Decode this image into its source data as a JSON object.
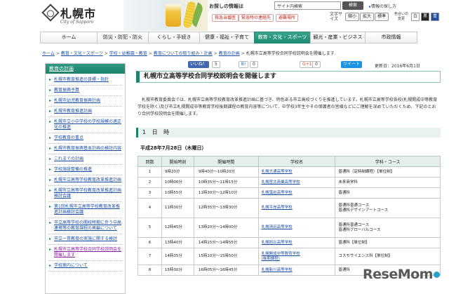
{
  "header": {
    "logo_text": "札幌市",
    "logo_sub": "City of Sapporo",
    "tagline": "お探しの情報は",
    "search_value": "サイト内検索",
    "search_button": "検索",
    "info_link": "情報の探し方",
    "emergency": [
      {
        "label": "救急当番医"
      },
      {
        "label": "緊急時の連絡先"
      },
      {
        "label": "避難場所"
      }
    ],
    "font_size_label": "文字サイズ",
    "font_sizes": [
      "縮小",
      "拡大",
      "標準"
    ],
    "bg_color_label": "色合いの変更",
    "bg_colors": [
      "白",
      "黒",
      "青"
    ]
  },
  "gnav": [
    "ホーム",
    "防災・防犯・防火",
    "くらし・手続き",
    "健康・福祉・子育て",
    "教育・文化・スポーツ",
    "観光・産業・ビジネス",
    "市政情報"
  ],
  "breadcrumb": {
    "links": [
      "ホーム",
      "教育・文化・スポーツ",
      "学校・幼稚園・教育",
      "教育についての取り組み・計画",
      "教育の計画"
    ],
    "current": "札幌市立高等学校合同学校説明会を開催します"
  },
  "sidebar": {
    "heading": "教育の計画",
    "items": [
      "札幌市教育推進の目標・指針",
      "教育振興予算",
      "札幌市幼児教育振興計画",
      "札幌市教育推進計画",
      "札幌市立小中学校の学校規模の適正化の推進",
      "学校教育の重点",
      "札幌市教育振興基本計画の検討内容",
      "これまでの計画",
      "学校施設整備の推進",
      "札幌市立高等学校教育改革推進計画",
      "札幌市立高等学校教育改革推進計画検討会議",
      "第1回札幌市立高等学校教育改革推進計画検討会議",
      "市立高等学校の開校時期に伴う中高連携等の教育課程の再編について",
      "市立一貫教育の実施に関する検討",
      "札幌市立高等学校合同学校説明会を開催します",
      "学校案内について"
    ]
  },
  "social": {
    "like": "いいね！",
    "like_count": "5",
    "hatena": "B!",
    "hatena_count": "0",
    "gplus": "G+1",
    "gplus_count": "0",
    "tweet": "ツイート",
    "updated": "更新日：2016年6月1日"
  },
  "page_title": "札幌市立高等学校合同学校説明会を開催します",
  "intro": "札幌市教育委員会では、札幌市立高等学校教育改革推進計画に基づき、特色ある市立高校づくりを推進しています。札幌市立高等学校各校(札幌開成中等教育学校を除く)及び市立札幌開成中等教育学校後期課程の教育内容等について、中学校3年生やその保護者の皆様などにご理解を深めていただくため、下記のとおり合同学校説明会を開催します。",
  "section_heading": "1 日 時",
  "date_line": "平成28年7月28日（木曜日）",
  "table": {
    "headers": [
      "回数",
      "開始時刻",
      "開催時間",
      "学校名",
      "学科・コース"
    ],
    "rows": [
      {
        "no": "1",
        "start": "9時20分",
        "time": "9時40分～10時20分",
        "school": "札幌大通高等学校",
        "course": "普通科（定時制課程）【単位制】"
      },
      {
        "no": "2",
        "start": "10時00分",
        "time": "10時35分～11時15分",
        "school": "札幌啓北商業高等学校",
        "course": "未来商学科"
      },
      {
        "no": "3",
        "start": "10時55分",
        "time": "11時30分～12時10分",
        "school": "札幌藻岩高等学校",
        "course": "普通科"
      },
      {
        "no": "4",
        "start": "11時30分",
        "time": "12時35分～13時30分",
        "school": "札幌平岸高等学校",
        "course": "普通科普通コース\n普通科デザインアートコース"
      },
      {
        "no": "5",
        "start": "12時45分",
        "time": "13時20分～14時00分",
        "school": "札幌清田高等学校",
        "course": "普通科普通コース\n普通科グローバルコース"
      },
      {
        "no": "6",
        "start": "13時40分",
        "time": "14時15分～14時55分",
        "school": "札幌旭丘高等学校",
        "course": "普通科【単位制】"
      },
      {
        "no": "7",
        "start": "14時35分",
        "time": "15時10分～15時50分",
        "school": "札幌開成中等教育学校\n(後期課程)",
        "course": "コスモサイエンス科【単位制】"
      },
      {
        "no": "8",
        "start": "15時30分",
        "time": "16時05分～16時45分",
        "school": "札幌新川高等学校",
        "course": "普通科"
      }
    ]
  },
  "watermark": "ReseMom"
}
